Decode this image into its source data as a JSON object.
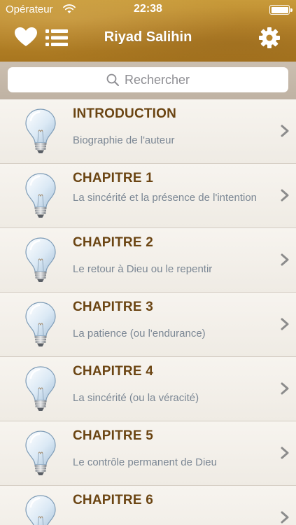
{
  "status_bar": {
    "carrier": "Opérateur",
    "time": "22:38"
  },
  "navbar": {
    "title": "Riyad Salihin"
  },
  "search": {
    "placeholder": "Rechercher"
  },
  "chapters": [
    {
      "title": "INTRODUCTION",
      "subtitle": "Biographie de l'auteur"
    },
    {
      "title": "CHAPITRE 1",
      "subtitle": "La sincérité et la présence de l'intention"
    },
    {
      "title": "CHAPITRE 2",
      "subtitle": "Le retour à Dieu ou le repentir"
    },
    {
      "title": "CHAPITRE 3",
      "subtitle": "La patience (ou l'endurance)"
    },
    {
      "title": "CHAPITRE 4",
      "subtitle": "La sincérité (ou la véracité)"
    },
    {
      "title": "CHAPITRE 5",
      "subtitle": "Le contrôle permanent de Dieu"
    },
    {
      "title": "CHAPITRE 6",
      "subtitle": ""
    }
  ],
  "colors": {
    "header_gold": "#b9862b",
    "title_brown": "#6b4513",
    "subtitle_gray": "#7b8794"
  },
  "icons": [
    "heart-icon",
    "list-icon",
    "gear-icon",
    "search-icon",
    "lightbulb-icon",
    "chevron-right-icon",
    "wifi-icon",
    "battery-icon"
  ]
}
